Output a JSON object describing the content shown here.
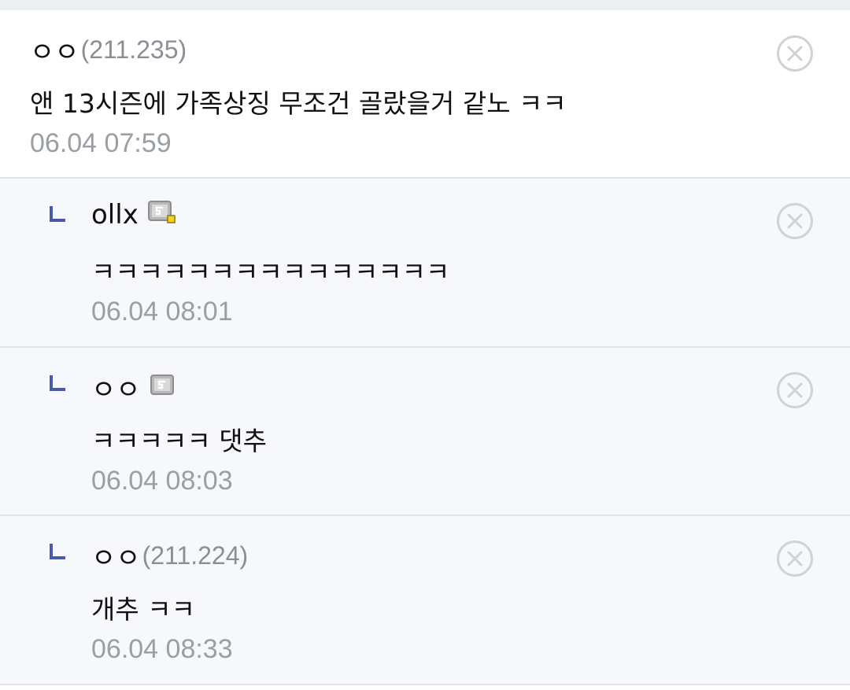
{
  "comments": [
    {
      "author": "ㅇㅇ",
      "ip": "(211.235)",
      "badge": "",
      "text": "앤 13시즌에 가족상징 무조건 골랐을거 같노 ㅋㅋ",
      "time": "06.04 07:59"
    }
  ],
  "replies": [
    {
      "author": "ollx",
      "ip": "",
      "badge": "gallog-fixed-icon",
      "text": "ㅋㅋㅋㅋㅋㅋㅋㅋㅋㅋㅋㅋㅋㅋㅋ",
      "time": "06.04 08:01"
    },
    {
      "author": "ㅇㅇ",
      "ip": "",
      "badge": "gallog-icon",
      "text": "ㅋㅋㅋㅋㅋ 댓추",
      "time": "06.04 08:03"
    },
    {
      "author": "ㅇㅇ",
      "ip": "(211.224)",
      "badge": "",
      "text": "개추 ㅋㅋ",
      "time": "06.04 08:33"
    }
  ],
  "icons": {
    "delete": "delete-circle-x-icon",
    "reply_marker": "reply-arrow-icon"
  },
  "colors": {
    "reply_marker": "#4a5aa8",
    "delete_icon": "#cfd2d7",
    "ip_text": "#8a8f96",
    "timestamp": "#9a9ea5",
    "reply_bg": "#f7f8fb",
    "divider": "#dfe3ea"
  }
}
